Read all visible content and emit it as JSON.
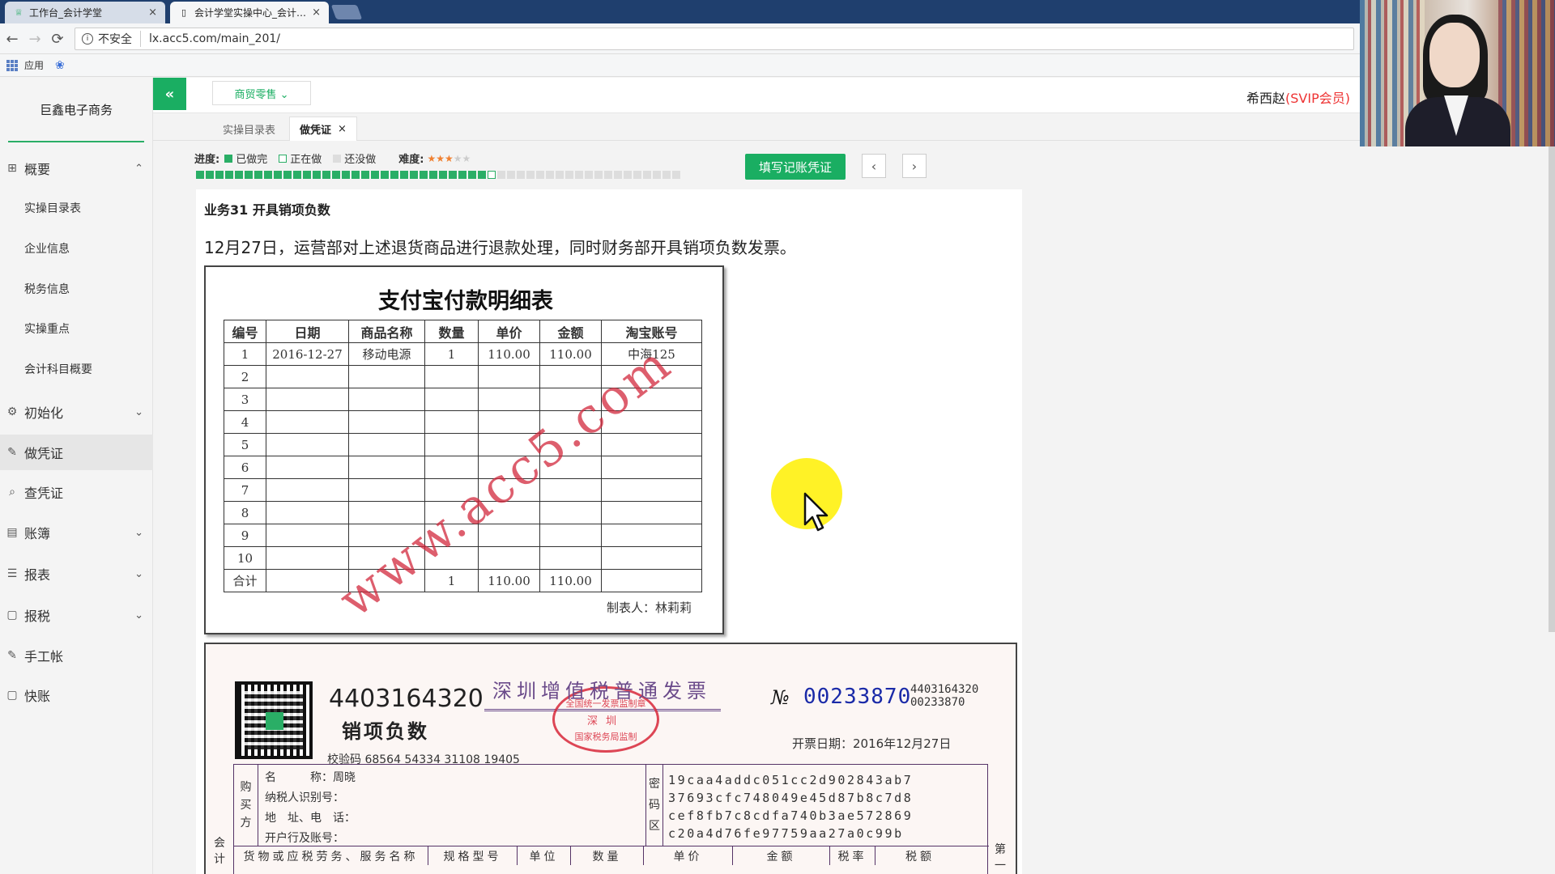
{
  "browser": {
    "tabs": [
      {
        "title": "工作台_会计学堂",
        "close": "×"
      },
      {
        "title": "会计学堂实操中心_会计…",
        "close": "×"
      }
    ],
    "nav": {
      "back": "←",
      "forward": "→",
      "reload": "⟳"
    },
    "security_label": "不安全",
    "url": "lx.acc5.com/main_201/",
    "bookmarks_label": "应用"
  },
  "sidebar": {
    "company": "巨鑫电子商务",
    "menu": [
      {
        "label": "概要",
        "icon": "grid-icon",
        "chevron": "⌃"
      },
      {
        "label": "初始化",
        "icon": "gear-icon",
        "chevron": "⌄"
      },
      {
        "label": "做凭证",
        "icon": "pencil-icon"
      },
      {
        "label": "查凭证",
        "icon": "search-icon"
      },
      {
        "label": "账簿",
        "icon": "book-icon",
        "chevron": "⌄"
      },
      {
        "label": "报表",
        "icon": "list-icon",
        "chevron": "⌄"
      },
      {
        "label": "报税",
        "icon": "file-icon",
        "chevron": "⌄"
      },
      {
        "label": "手工帐",
        "icon": "pencil-icon"
      },
      {
        "label": "快账",
        "icon": "file-icon"
      }
    ],
    "submenu": [
      "实操目录表",
      "企业信息",
      "税务信息",
      "实操重点",
      "会计科目概要"
    ]
  },
  "header": {
    "collapse_icon": "«",
    "industry": "商贸零售 ⌄",
    "user": "希西赵",
    "vip": "(SVIP会员)"
  },
  "subtabs": [
    {
      "label": "实操目录表"
    },
    {
      "label": "做凭证",
      "close": "×"
    }
  ],
  "progress": {
    "label": "进度:",
    "legend_done": "已做完",
    "legend_doing": "正在做",
    "legend_todo": "还没做",
    "difficulty_label": "难度:",
    "difficulty_stars": 3,
    "difficulty_max": 5,
    "done_count": 30,
    "doing_index": 31,
    "total": 50,
    "fill_button": "填写记账凭证",
    "prev": "‹",
    "next": "›",
    "colors": {
      "done": "#2aae66",
      "todo": "#dddddd"
    }
  },
  "task": {
    "title": "业务31 开具销项负数",
    "description": "12月27日，运营部对上述退货商品进行退款处理，同时财务部开具销项负数发票。"
  },
  "alipay_sheet": {
    "title": "支付宝付款明细表",
    "columns": [
      "编号",
      "日期",
      "商品名称",
      "数量",
      "单价",
      "金额",
      "淘宝账号"
    ],
    "rows": [
      [
        "1",
        "2016-12-27",
        "移动电源",
        "1",
        "110.00",
        "110.00",
        "中海125"
      ],
      [
        "2",
        "",
        "",
        "",
        "",
        "",
        ""
      ],
      [
        "3",
        "",
        "",
        "",
        "",
        "",
        ""
      ],
      [
        "4",
        "",
        "",
        "",
        "",
        "",
        ""
      ],
      [
        "5",
        "",
        "",
        "",
        "",
        "",
        ""
      ],
      [
        "6",
        "",
        "",
        "",
        "",
        "",
        ""
      ],
      [
        "7",
        "",
        "",
        "",
        "",
        "",
        ""
      ],
      [
        "8",
        "",
        "",
        "",
        "",
        "",
        ""
      ],
      [
        "9",
        "",
        "",
        "",
        "",
        "",
        ""
      ],
      [
        "10",
        "",
        "",
        "",
        "",
        "",
        ""
      ]
    ],
    "total_row": [
      "合计",
      "",
      "",
      "1",
      "110.00",
      "110.00",
      ""
    ],
    "maker": "制表人：林莉莉",
    "watermark": "www.acc5.com"
  },
  "invoice": {
    "code": "4403164320",
    "negative_label": "销项负数",
    "check_code": "校验码 68564 54334 31108 19405",
    "title": "深圳增值税普通发票",
    "seal_top": "全国统一发票监制章",
    "seal_mid": "深圳",
    "seal_bottom": "国家税务局监制",
    "no_label": "№",
    "number": "00233870",
    "small_code": "4403164320",
    "small_number": "00233870",
    "issue_date": "开票日期：2016年12月27日",
    "buyer_side": [
      "购",
      "买",
      "方"
    ],
    "buyer_name_label": "名　　　称：",
    "buyer_name": "周晓",
    "buyer_fields": [
      "纳税人识别号：",
      "地　址、电　话：",
      "开户行及账号："
    ],
    "pw_side": [
      "密",
      "码",
      "区"
    ],
    "password_lines": [
      "19caa4addc051cc2d902843ab7",
      "37693cfc748049e45d87b8c7d8",
      "cef8fb7c8cdfa740b3ae572869",
      "c20a4d76fe97759aa27a0c99b"
    ],
    "item_headers": [
      "货物或应税劳务、服务名称",
      "规格型号",
      "单位",
      "数量",
      "单价",
      "金额",
      "税率",
      "税额"
    ],
    "left_label": [
      "会",
      "计"
    ],
    "right_label": [
      "第",
      "一"
    ]
  }
}
